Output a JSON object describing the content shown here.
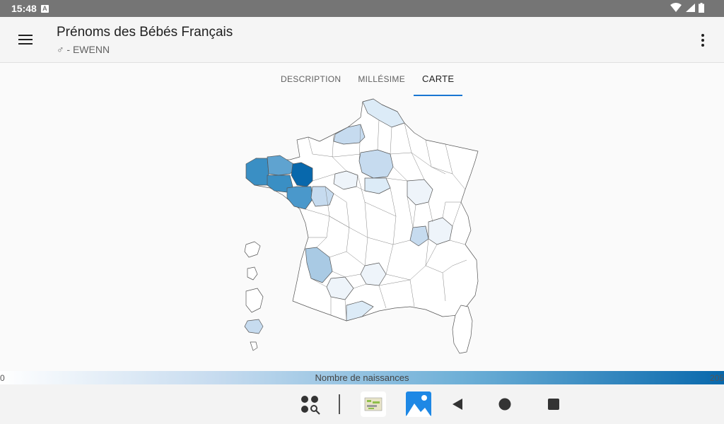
{
  "status": {
    "time": "15:48",
    "notif_glyph": "A"
  },
  "appbar": {
    "title": "Prénoms des Bébés Français",
    "subtitle": "♂ - EWENN"
  },
  "tabs": [
    {
      "label": "DESCRIPTION",
      "active": false
    },
    {
      "label": "MILLÉSIME",
      "active": false
    },
    {
      "label": "CARTE",
      "active": true
    }
  ],
  "legend": {
    "min": "0",
    "label": "Nombre de naissances",
    "max": "205"
  },
  "colors": {
    "accent": "#1976d2",
    "map_dark": "#0868ac",
    "map_mid": "#3a8fc4",
    "map_light": "#c6dbef"
  }
}
